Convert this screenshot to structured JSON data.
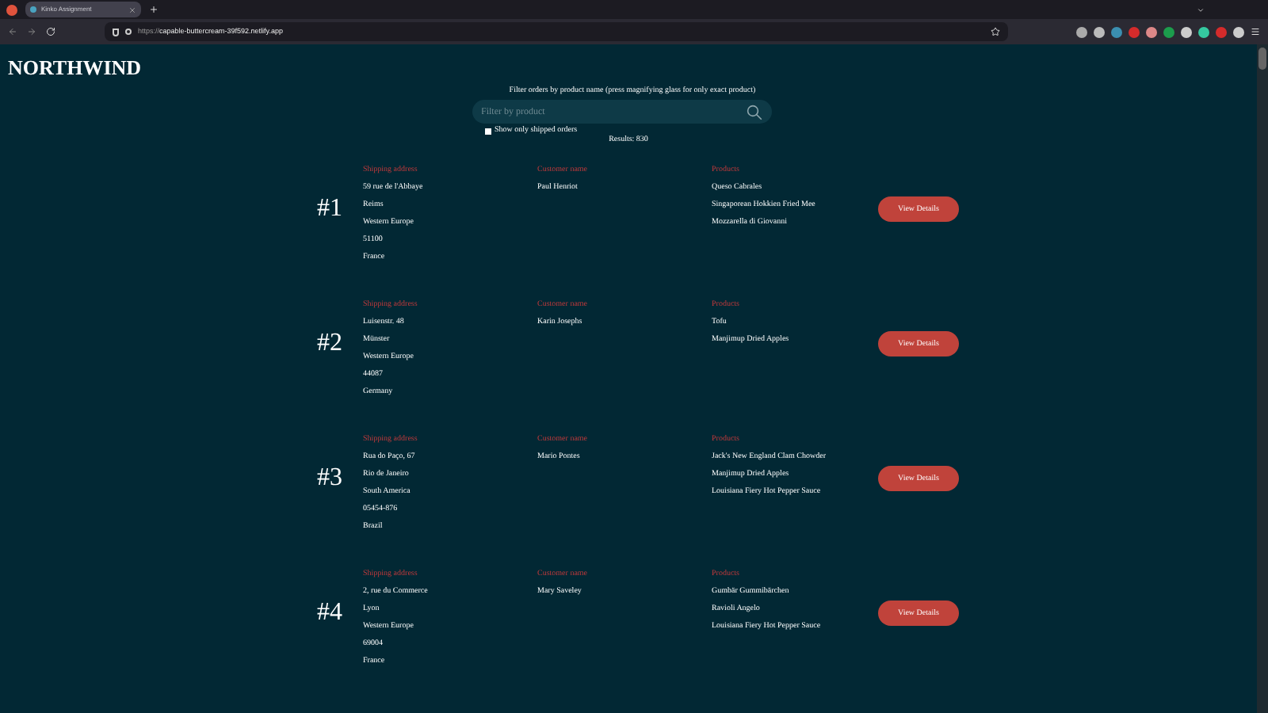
{
  "browser": {
    "tab_title": "Kinko Assignment",
    "url_scheme": "https://",
    "url_host": "capable-buttercream-39f592.netlify.app"
  },
  "brand": "NORTHWIND",
  "filter": {
    "label": "Filter orders by product name (press magnifying glass for only exact product)",
    "placeholder": "Filter by product",
    "shipped_only": {
      "label": "Show only shipped orders",
      "checked": false
    },
    "results": "Results: 830"
  },
  "orders": [
    {
      "number": "#1",
      "address_label": "Shipping address",
      "address": [
        "59 rue de l'Abbaye",
        "Reims",
        "Western Europe",
        "51100",
        "France"
      ],
      "customer_label": "Customer name",
      "customer": "Paul Henriot",
      "products_label": "Products",
      "products": [
        "Queso Cabrales",
        "Singaporean Hokkien Fried Mee",
        "Mozzarella di Giovanni"
      ],
      "button": "View Details"
    },
    {
      "number": "#2",
      "address_label": "Shipping address",
      "address": [
        "Luisenstr. 48",
        "Münster",
        "Western Europe",
        "44087",
        "Germany"
      ],
      "customer_label": "Customer name",
      "customer": "Karin Josephs",
      "products_label": "Products",
      "products": [
        "Tofu",
        "Manjimup Dried Apples"
      ],
      "button": "View Details"
    },
    {
      "number": "#3",
      "address_label": "Shipping address",
      "address": [
        "Rua do Paço, 67",
        "Rio de Janeiro",
        "South America",
        "05454-876",
        "Brazil"
      ],
      "customer_label": "Customer name",
      "customer": "Mario Pontes",
      "products_label": "Products",
      "products": [
        "Jack's New England Clam Chowder",
        "Manjimup Dried Apples",
        "Louisiana Fiery Hot Pepper Sauce"
      ],
      "button": "View Details"
    },
    {
      "number": "#4",
      "address_label": "Shipping address",
      "address": [
        "2, rue du Commerce",
        "Lyon",
        "Western Europe",
        "69004",
        "France"
      ],
      "customer_label": "Customer name",
      "customer": "Mary Saveley",
      "products_label": "Products",
      "products": [
        "Gumbär Gummibärchen",
        "Ravioli Angelo",
        "Louisiana Fiery Hot Pepper Sauce"
      ],
      "button": "View Details"
    }
  ]
}
